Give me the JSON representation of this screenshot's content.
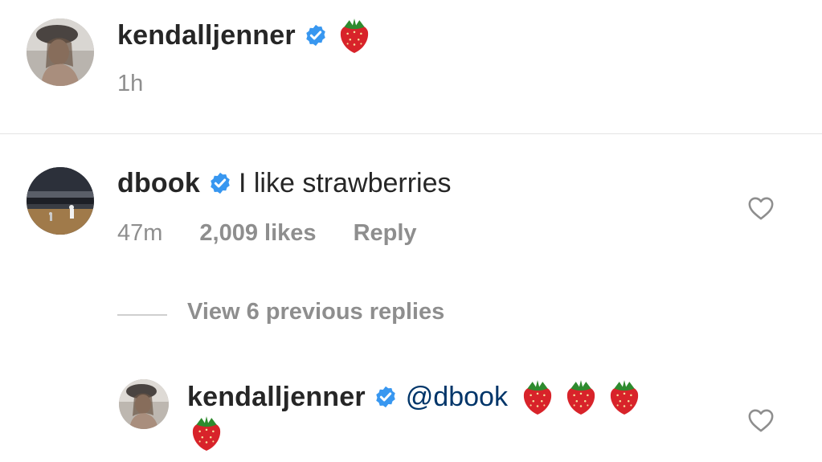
{
  "caption": {
    "username": "kendalljenner",
    "emoji": "strawberry",
    "time": "1h"
  },
  "comment": {
    "username": "dbook",
    "text": "I like strawberries",
    "time": "47m",
    "likes": "2,009 likes",
    "reply_label": "Reply"
  },
  "replies_toggle": {
    "label": "View 6 previous replies"
  },
  "reply": {
    "username": "kendalljenner",
    "mention": "@dbook",
    "emoji_count": 4
  },
  "colors": {
    "verified_badge": "#3897f0",
    "mention": "#003569",
    "meta": "#8e8e8e",
    "divider": "#e4e4e4",
    "strawberry": "#d8232a"
  },
  "icons": {
    "verified": "verified-badge-icon",
    "like": "heart-outline-icon",
    "emoji": "strawberry-icon"
  }
}
